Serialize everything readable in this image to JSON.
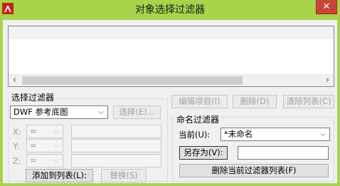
{
  "window": {
    "title": "对象选择过滤器",
    "close_glyph": "✕",
    "icon": "autocad-logo-icon"
  },
  "list": {
    "scroll_left": "‹",
    "scroll_right": "›"
  },
  "select_filter": {
    "group_title": "选择过滤器",
    "type_value": "DWF 参考底图",
    "select_button": "选择(E)...",
    "x_label": "X:",
    "y_label": "Y:",
    "z_label": "Z:",
    "operator_value": "=",
    "add_button": "添加到列表(L):",
    "replace_button": "替换(S)"
  },
  "list_actions": {
    "edit_item": "编辑项目(I)",
    "delete": "删除(D)",
    "clear_list": "清除列表(C)"
  },
  "named_filter": {
    "group_title": "命名过滤器",
    "current_label": "当前(U):",
    "current_value": "*未命名",
    "save_as_button": "另存为(V):",
    "save_as_value": "",
    "delete_current_button": "删除当前过滤器列表(F)"
  },
  "colors": {
    "titlebar": "#a8d44c",
    "close": "#c7463a",
    "client": "#f0f0f0"
  }
}
